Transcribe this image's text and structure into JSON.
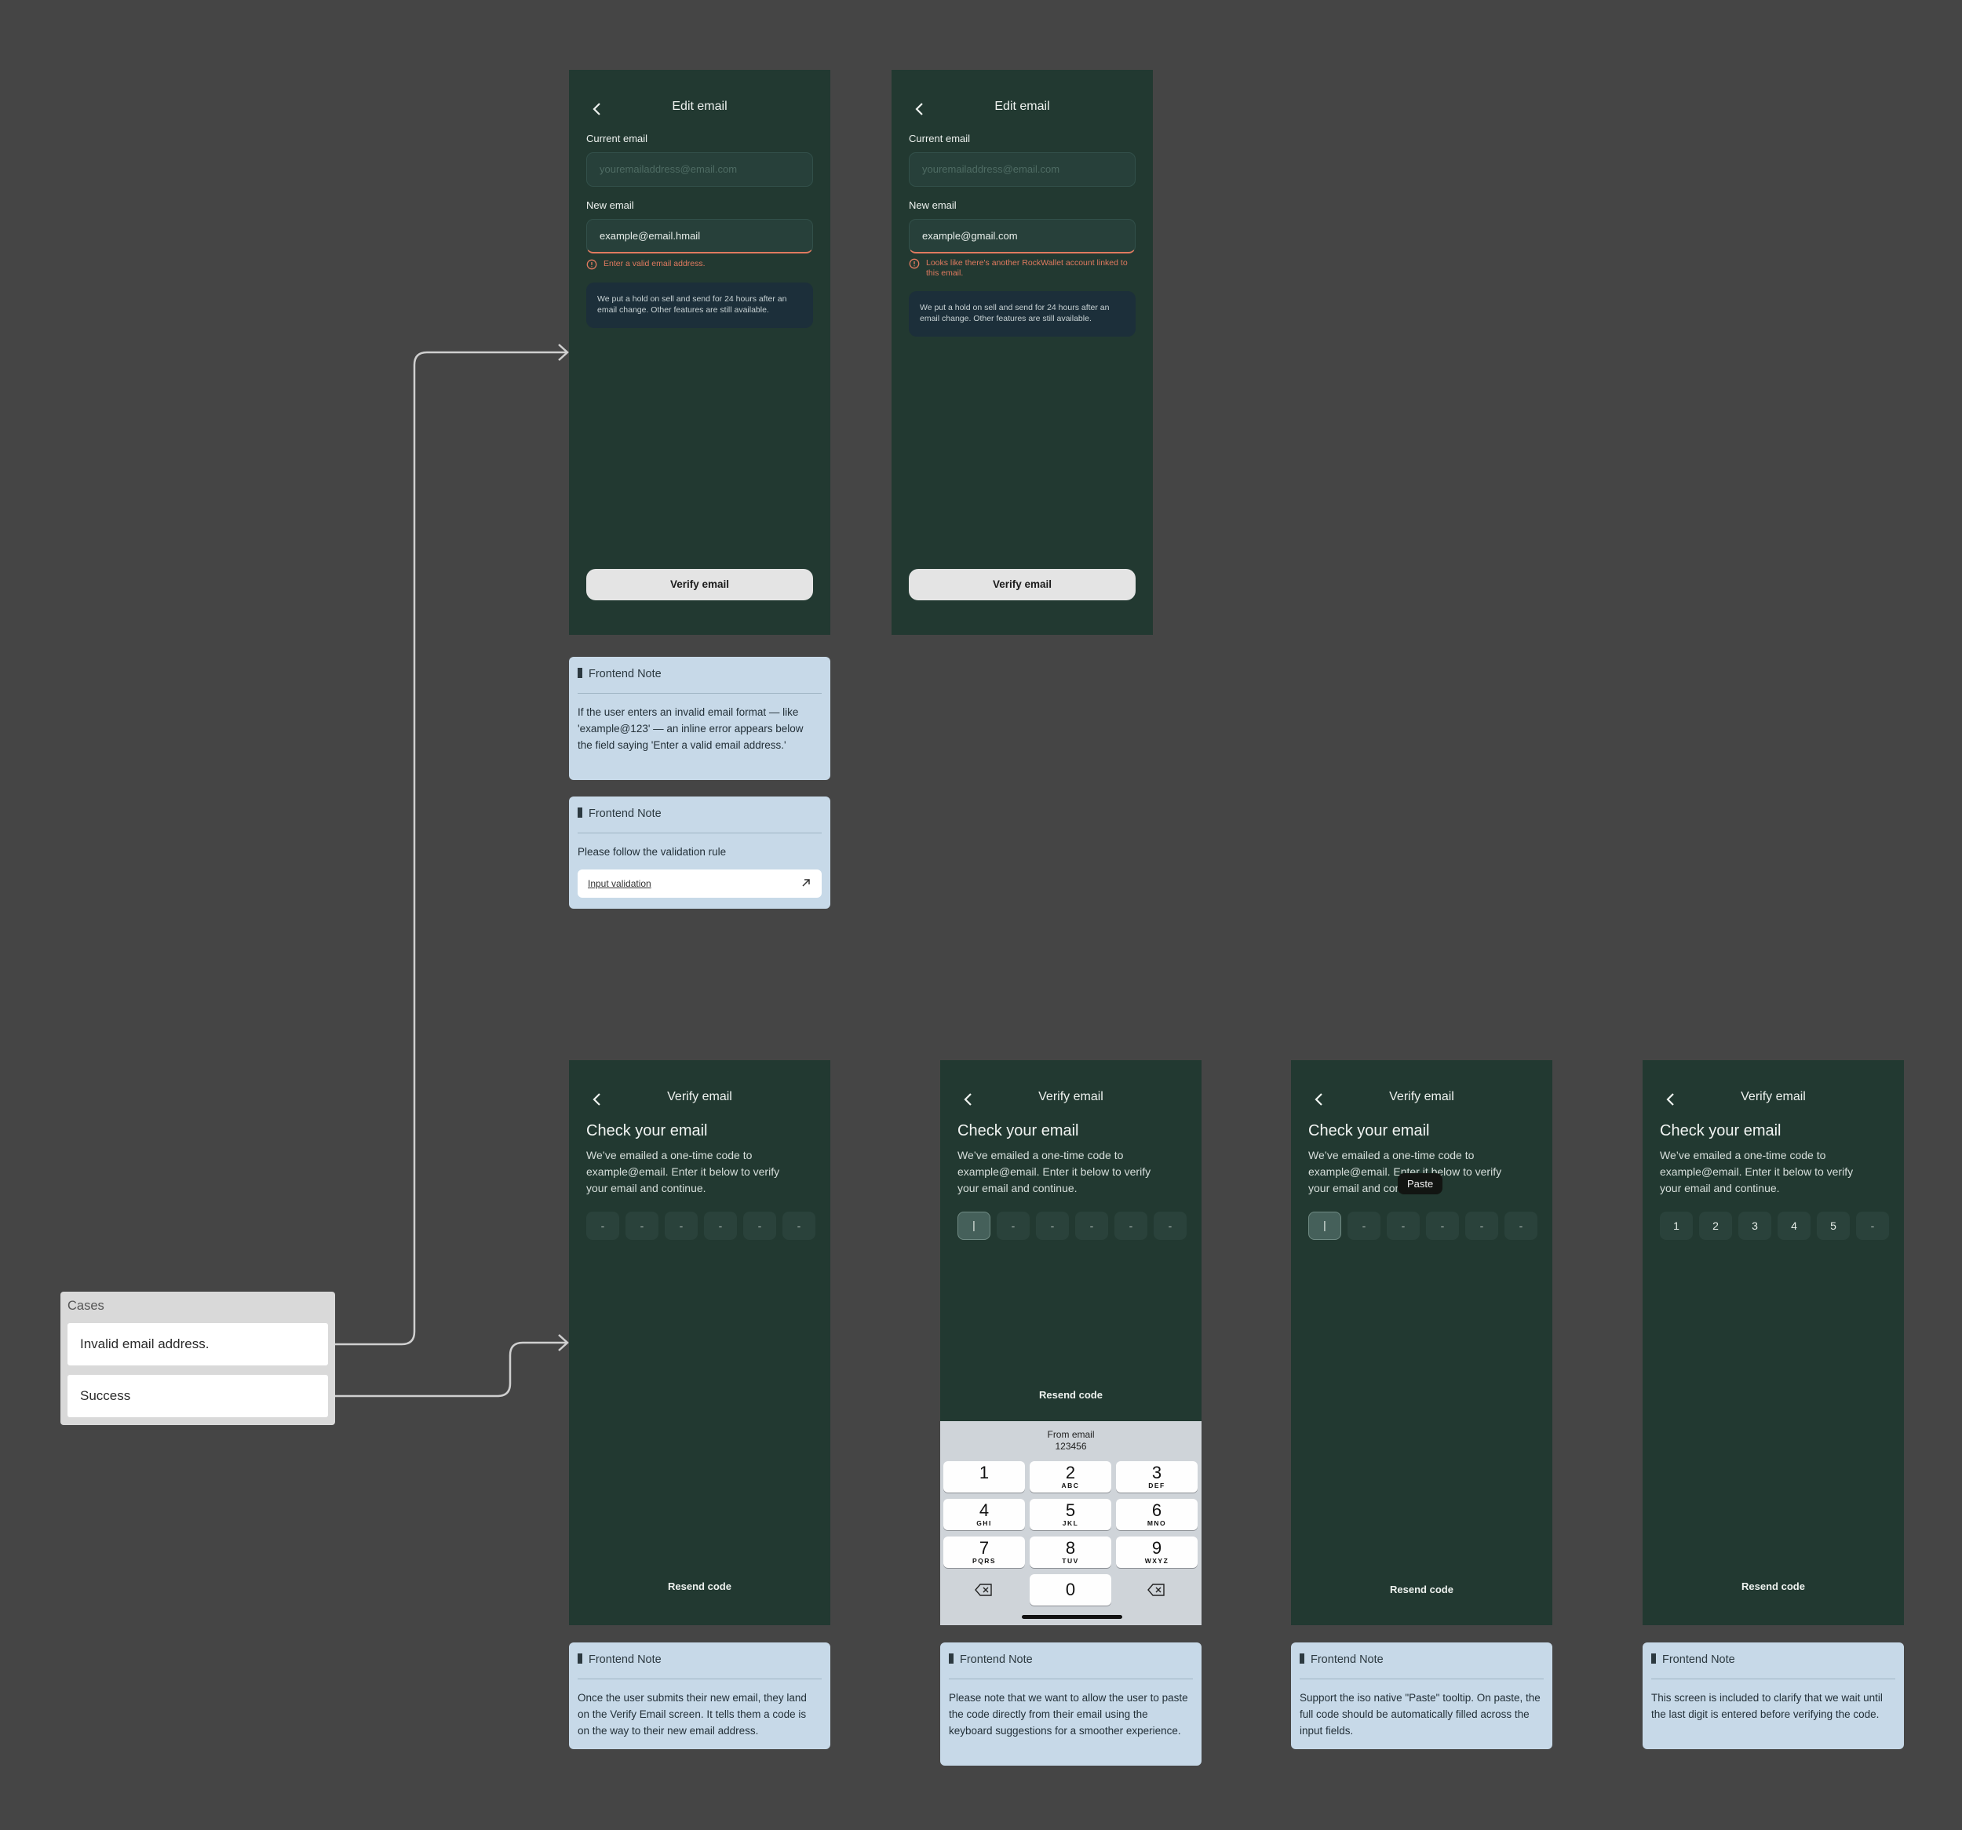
{
  "edit_email": {
    "title": "Edit email",
    "current_email_label": "Current email",
    "current_email_placeholder": "youremailaddress@email.com",
    "new_email_label": "New email",
    "hold_info": "We put a hold on sell and send for 24 hours after an email change. Other features are still available.",
    "verify_button": "Verify email"
  },
  "edit_invalid": {
    "new_email_value": "example@email.hmail",
    "error": "Enter a valid email address."
  },
  "edit_exists": {
    "new_email_value": "example@gmail.com",
    "error": "Looks like there's another RockWallet account linked to this email."
  },
  "verify_email": {
    "title": "Verify email",
    "heading": "Check your email",
    "body": "We’ve emailed a one-time code to example@email. Enter it below to verify your email and continue.",
    "resend": "Resend code",
    "empty_digit": "-",
    "cursor": "|",
    "filled_digits": [
      "1",
      "2",
      "3",
      "4",
      "5",
      "-"
    ]
  },
  "keyboard": {
    "suggestion_from": "From email",
    "suggestion_code": "123456",
    "keys": [
      {
        "n": "1",
        "l": ""
      },
      {
        "n": "2",
        "l": "ABC"
      },
      {
        "n": "3",
        "l": "DEF"
      },
      {
        "n": "4",
        "l": "GHI"
      },
      {
        "n": "5",
        "l": "JKL"
      },
      {
        "n": "6",
        "l": "MNO"
      },
      {
        "n": "7",
        "l": "PQRS"
      },
      {
        "n": "8",
        "l": "TUV"
      },
      {
        "n": "9",
        "l": "WXYZ"
      },
      {
        "n": "0",
        "l": ""
      }
    ]
  },
  "tooltip": {
    "paste": "Paste"
  },
  "notes": {
    "header": "Frontend Note",
    "invalid_format": "If the user enters an invalid email format — like 'example@123' — an inline error appears below the field saying 'Enter a valid email address.'",
    "validation_rule": "Please follow the validation rule",
    "validation_link": "Input validation",
    "verify_land": "Once the user submits their new email, they land on the Verify Email screen. It tells them a code is on the way to their new email address.",
    "paste_from_keyboard": "Please note that we want to allow the user to paste the code directly from their email using the keyboard suggestions for a smoother experience.",
    "ios_paste": "Support the iso native \"Paste\" tooltip. On paste, the full code should be automatically filled across the input fields.",
    "wait_last_digit": "This screen is included to clarify that we wait until the last digit is entered before verifying the code."
  },
  "cases": {
    "title": "Cases",
    "items": [
      "Invalid email address.",
      "Success"
    ]
  },
  "colors": {
    "canvas": "#454545",
    "screen_bg": "#223931",
    "note_bg": "#c7d9e8",
    "error": "#e07a5f",
    "connector": "#cfcfcf"
  }
}
